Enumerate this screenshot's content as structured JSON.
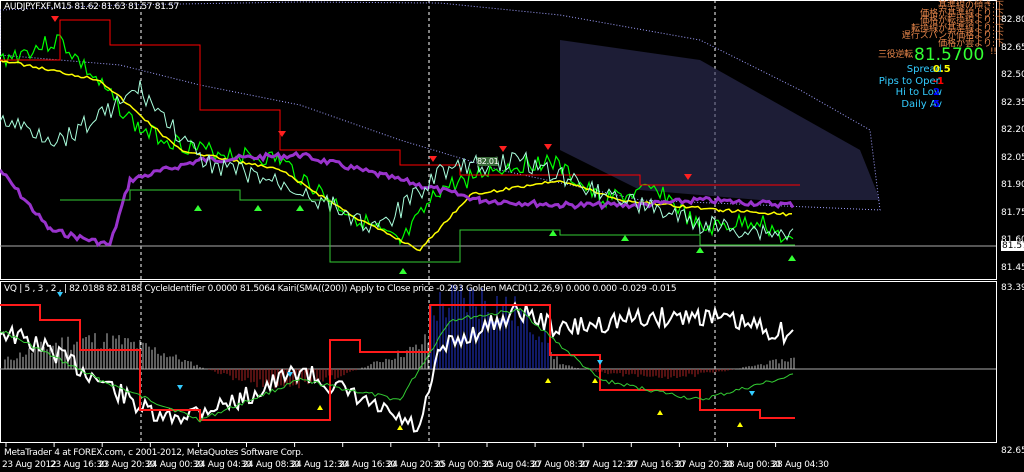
{
  "main": {
    "title": "AUDJPYFXF,M15  81.62 81.63 81.57 81.57",
    "ichimoku_status": [
      "基準線の傾き:下",
      "価格が基準線より:下",
      "価格が転換線より:下",
      "転換線が基準線より:下",
      "遅行スパンが価格より:下",
      "価格が雲より:下"
    ],
    "sanyaku": "三役逆転",
    "sanyaku_tail": "!!",
    "price_big": "81.5700",
    "stats": [
      {
        "label": "Spread",
        "value": "0.5",
        "color": "#ffff00"
      },
      {
        "label": "Pips to Open",
        "value": "-1",
        "color": "#ff0000"
      },
      {
        "label": "Hi to Low",
        "value": "2",
        "color": "#0000ff"
      },
      {
        "label": "Daily Av",
        "value": "5",
        "color": "#0000ff"
      }
    ],
    "price_axis": [
      "82.80",
      "82.65",
      "82.50",
      "82.35",
      "82.20",
      "82.05",
      "81.90",
      "81.75",
      "81.60",
      "81.45"
    ],
    "current_price": "81.57",
    "line_label": "82.01"
  },
  "sub": {
    "legend": "VQ |  5 , 3 , 2 ,  |  82.0188 82.8188  CycleIdentifier 0.0000 81.5064  Kairi(SMA((200)) Apply to Close price -0.293  Golden MACD(12,26,9) 0.000 0.000 -0.029 -0.015",
    "axis_top": "83.3935",
    "axis_bottom": "82.6578",
    "copyright": "MetaTrader 4 at FOREX.com, c 2001-2012, MetaQuotes Software Corp."
  },
  "time_axis": [
    "23 Aug 2012",
    "23 Aug 16:30",
    "23 Aug 20:30",
    "24 Aug 00:30",
    "24 Aug 04:30",
    "24 Aug 08:30",
    "24 Aug 12:30",
    "24 Aug 16:30",
    "24 Aug 20:30",
    "25 Aug 00:30",
    "25 Aug 04:30",
    "27 Aug 08:30",
    "27 Aug 12:30",
    "27 Aug 16:30",
    "27 Aug 20:30",
    "28 Aug 00:30",
    "28 Aug 04:30"
  ],
  "colors": {
    "bg": "#000000",
    "grid": "#ffffff",
    "bull": "#00ff00",
    "kijun": "#ff0000",
    "tenkan": "#ffff00",
    "chikou": "#9933cc",
    "cloud": "#a0a0ff"
  }
}
